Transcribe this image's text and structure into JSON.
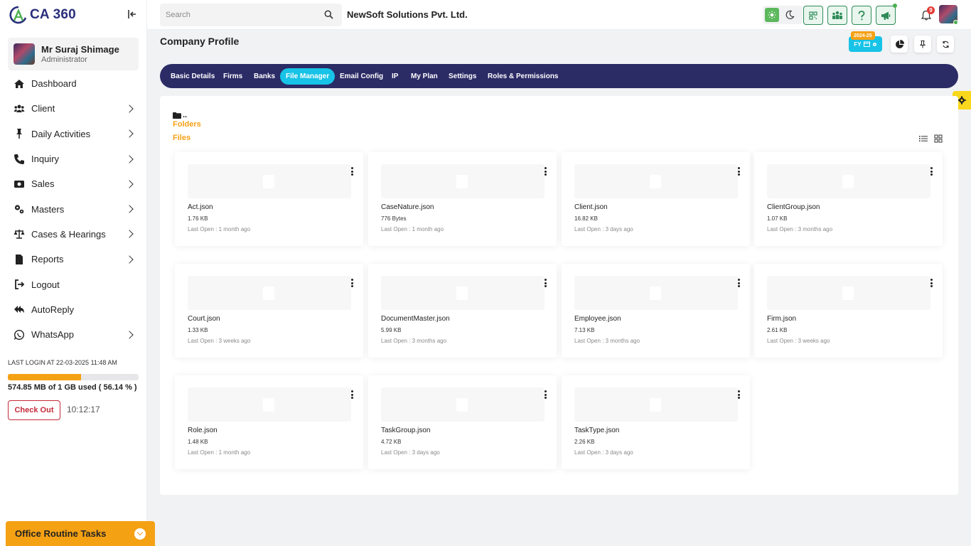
{
  "brand": {
    "name": "CA 360"
  },
  "profile": {
    "name": "Mr Suraj Shimage",
    "role": "Administrator"
  },
  "sidebar": {
    "items": [
      {
        "label": "Dashboard",
        "icon": "home-icon",
        "has_children": false
      },
      {
        "label": "Client",
        "icon": "users-icon",
        "has_children": true
      },
      {
        "label": "Daily Activities",
        "icon": "pin-icon",
        "has_children": true
      },
      {
        "label": "Inquiry",
        "icon": "phone-icon",
        "has_children": true
      },
      {
        "label": "Sales",
        "icon": "money-icon",
        "has_children": true
      },
      {
        "label": "Masters",
        "icon": "gears-icon",
        "has_children": true
      },
      {
        "label": "Cases & Hearings",
        "icon": "scale-icon",
        "has_children": true
      },
      {
        "label": "Reports",
        "icon": "file-icon",
        "has_children": true
      },
      {
        "label": "Logout",
        "icon": "logout-icon",
        "has_children": false
      },
      {
        "label": "AutoReply",
        "icon": "reply-all-icon",
        "has_children": false
      },
      {
        "label": "WhatsApp",
        "icon": "whatsapp-icon",
        "has_children": true
      }
    ]
  },
  "session": {
    "last_login": "LAST LOGIN AT 22-03-2025 11:48 AM",
    "storage_text": "574.85 MB of 1 GB used ( 56.14 % )",
    "storage_fraction": 0.5614,
    "checkout_label": "Check Out",
    "clock": "10:12:17"
  },
  "routine": {
    "label": "Office Routine Tasks"
  },
  "topbar": {
    "search_placeholder": "Search",
    "company": "NewSoft Solutions Pvt. Ltd.",
    "notification_count": "9"
  },
  "page": {
    "title": "Company Profile",
    "fy_label": "FY",
    "fy_year": "2024-25"
  },
  "tabs": [
    {
      "label": "Basic Details",
      "active": false
    },
    {
      "label": "Firms",
      "active": false
    },
    {
      "label": "Banks",
      "active": false
    },
    {
      "label": "File Manager",
      "active": true
    },
    {
      "label": "Email Config",
      "active": false
    },
    {
      "label": "IP",
      "active": false
    },
    {
      "label": "My Plan",
      "active": false
    },
    {
      "label": "Settings",
      "active": false
    },
    {
      "label": "Roles & Permissions",
      "active": false
    }
  ],
  "file_manager": {
    "breadcrumb": "..",
    "folders_label": "Folders",
    "files_label": "Files",
    "files": [
      {
        "name": "Act.json",
        "size": "1.76 KB",
        "last_open": "Last Open : 1 month ago"
      },
      {
        "name": "CaseNature.json",
        "size": "776 Bytes",
        "last_open": "Last Open : 1 month ago"
      },
      {
        "name": "Client.json",
        "size": "16.82 KB",
        "last_open": "Last Open : 3 days ago"
      },
      {
        "name": "ClientGroup.json",
        "size": "1.07 KB",
        "last_open": "Last Open : 3 months ago"
      },
      {
        "name": "Court.json",
        "size": "1.33 KB",
        "last_open": "Last Open : 3 weeks ago"
      },
      {
        "name": "DocumentMaster.json",
        "size": "5.99 KB",
        "last_open": "Last Open : 3 months ago"
      },
      {
        "name": "Employee.json",
        "size": "7.13 KB",
        "last_open": "Last Open : 3 months ago"
      },
      {
        "name": "Firm.json",
        "size": "2.61 KB",
        "last_open": "Last Open : 3 weeks ago"
      },
      {
        "name": "Role.json",
        "size": "1.48 KB",
        "last_open": "Last Open : 1 month ago"
      },
      {
        "name": "TaskGroup.json",
        "size": "4.72 KB",
        "last_open": "Last Open : 3 days ago"
      },
      {
        "name": "TaskType.json",
        "size": "2.26 KB",
        "last_open": "Last Open : 3 days ago"
      }
    ]
  },
  "colors": {
    "accent_orange": "#f5a114",
    "tab_bar": "#2b2b66",
    "tab_active": "#17c3e6",
    "brand_green": "#2e8b57",
    "danger": "#c52a3a"
  }
}
